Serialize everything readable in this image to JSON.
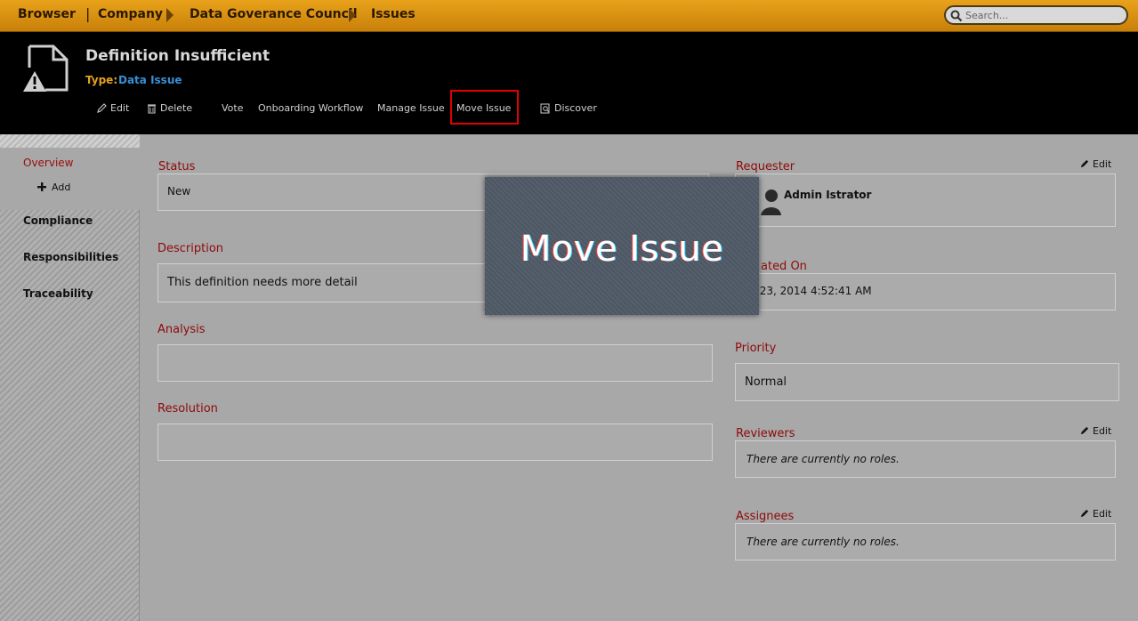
{
  "breadcrumb": {
    "items": [
      "Browser",
      "Company",
      "Data Goverance Council",
      "Issues"
    ],
    "separator": "|"
  },
  "search": {
    "placeholder": "Search..."
  },
  "asset": {
    "title": "Definition Insufficient",
    "type_label": "Type:",
    "type_value": "Data Issue"
  },
  "actions": {
    "edit": "Edit",
    "delete": "Delete",
    "vote": "Vote",
    "onboarding": "Onboarding Workflow",
    "manage": "Manage Issue",
    "move": "Move Issue",
    "discover": "Discover"
  },
  "sidebar": {
    "overview": "Overview",
    "add": "Add",
    "compliance": "Compliance",
    "responsibilities": "Responsibilities",
    "traceability": "Traceability"
  },
  "fields": {
    "status": {
      "label": "Status",
      "value": "New"
    },
    "description": {
      "label": "Description",
      "value": "This definition needs more detail"
    },
    "analysis": {
      "label": "Analysis",
      "value": ""
    },
    "resolution": {
      "label": "Resolution",
      "value": ""
    },
    "requester": {
      "label": "Requester",
      "value": "Admin Istrator",
      "edit": "Edit"
    },
    "created_on": {
      "label": "ated On",
      "value": "r 23, 2014 4:52:41 AM"
    },
    "priority": {
      "label": "Priority",
      "value": "Normal"
    },
    "reviewers": {
      "label": "Reviewers",
      "value": "There are currently no roles.",
      "edit": "Edit"
    },
    "assignees": {
      "label": "Assignees",
      "value": "There are currently no roles.",
      "edit": "Edit"
    }
  },
  "zoom_callout": {
    "text": "Move Issue"
  },
  "colors": {
    "topbar": "#d58f12",
    "header": "#000000",
    "label_red": "#8e0a0a",
    "type_link": "#3a8ed6",
    "highlight": "#e10000"
  }
}
